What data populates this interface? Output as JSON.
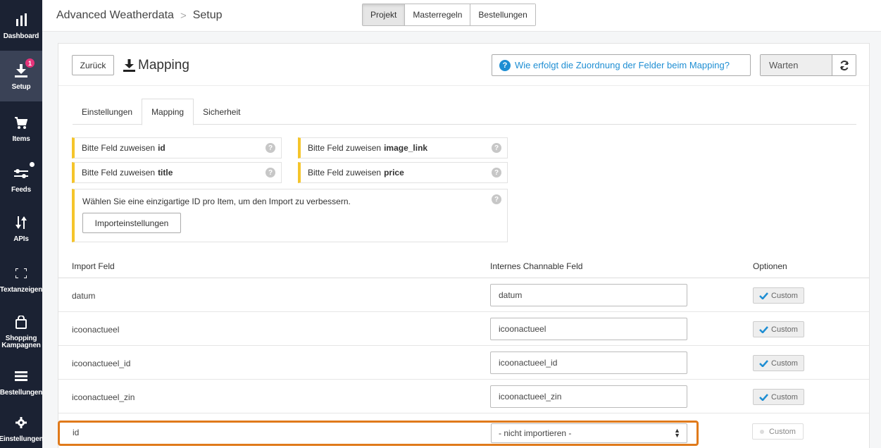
{
  "sidebar": {
    "items": [
      {
        "label": "Dashboard",
        "icon": "bar-chart-icon"
      },
      {
        "label": "Setup",
        "icon": "download-icon",
        "badge": "1"
      },
      {
        "label": "Items",
        "icon": "cart-icon"
      },
      {
        "label": "Feeds",
        "icon": "sliders-icon"
      },
      {
        "label": "APIs",
        "icon": "arrows-updown-icon"
      },
      {
        "label": "Textanzeigen",
        "icon": "expand-icon"
      },
      {
        "label": "Shopping Kampagnen",
        "icon": "bag-icon"
      },
      {
        "label": "Bestellungen",
        "icon": "list-icon"
      },
      {
        "label": "Einstellungen",
        "icon": "gear-icon"
      }
    ]
  },
  "topbar": {
    "breadcrumb": [
      "Advanced Weatherdata",
      "Setup"
    ],
    "nav": [
      "Projekt",
      "Masterregeln",
      "Bestellungen"
    ]
  },
  "header": {
    "back": "Zurück",
    "title": "Mapping",
    "help": "Wie erfolgt die Zuordnung der Felder beim Mapping?",
    "status": "Warten"
  },
  "tabs": [
    "Einstellungen",
    "Mapping",
    "Sicherheit"
  ],
  "warnings": [
    {
      "prefix": "Bitte Feld zuweisen",
      "field": "id"
    },
    {
      "prefix": "Bitte Feld zuweisen",
      "field": "image_link"
    },
    {
      "prefix": "Bitte Feld zuweisen",
      "field": "title"
    },
    {
      "prefix": "Bitte Feld zuweisen",
      "field": "price"
    }
  ],
  "notice": {
    "text": "Wählen Sie eine einzigartige ID pro Item, um den Import zu verbessern.",
    "button": "Importeinstellungen"
  },
  "table": {
    "headers": [
      "Import Feld",
      "Internes Channable Feld",
      "Optionen"
    ],
    "rows": [
      {
        "name": "datum",
        "value": "datum",
        "option": "Custom"
      },
      {
        "name": "icoonactueel",
        "value": "icoonactueel",
        "option": "Custom"
      },
      {
        "name": "icoonactueel_id",
        "value": "icoonactueel_id",
        "option": "Custom"
      },
      {
        "name": "icoonactueel_zin",
        "value": "icoonactueel_zin",
        "option": "Custom"
      }
    ],
    "highlight": {
      "name": "id",
      "value": "- nicht importieren -",
      "option": "Custom"
    }
  },
  "colors": {
    "sidebar": "#1b2233",
    "accent": "#1e8ed3",
    "warning": "#f5c52b",
    "highlight": "#e07a1b"
  }
}
